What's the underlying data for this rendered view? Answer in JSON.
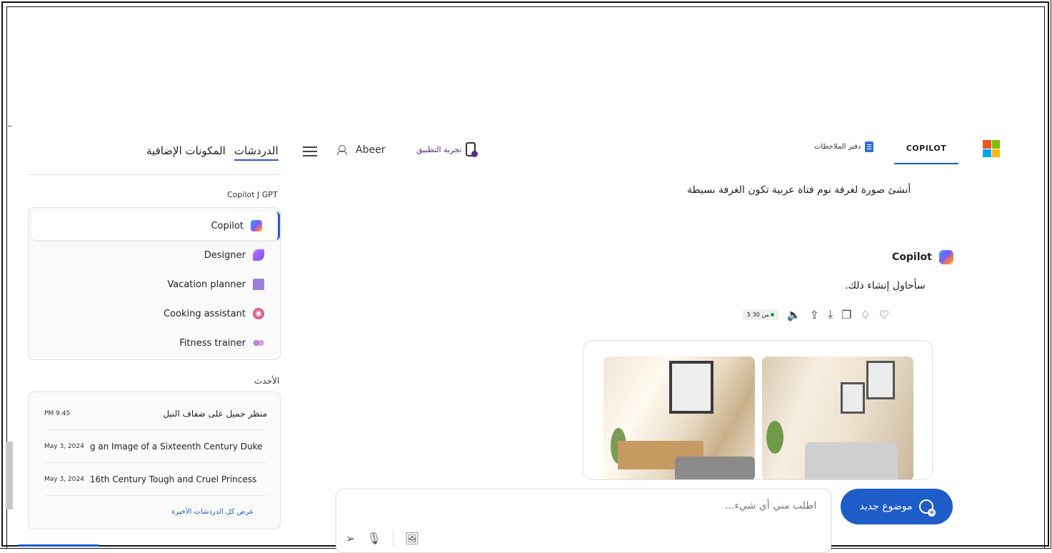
{
  "colors": {
    "accent": "#1e5cc8",
    "app_purple": "#5b2c8a"
  },
  "header": {
    "copilot_tab": "COPILOT",
    "notebook_tab": "دفتر الملاحظات",
    "try_app": "تجربة التطبيق",
    "user_name": "Abeer"
  },
  "sidebar": {
    "tabs": [
      {
        "label": "الدردشات"
      },
      {
        "label": "المكونات الإضافية"
      }
    ],
    "gpt_section_title": "Copilot J GPT",
    "gpts": [
      {
        "label": "Copilot",
        "icon": "copilot-icon"
      },
      {
        "label": "Designer",
        "icon": "designer-icon"
      },
      {
        "label": "Vacation planner",
        "icon": "suitcase-icon"
      },
      {
        "label": "Cooking assistant",
        "icon": "cooking-icon"
      },
      {
        "label": "Fitness trainer",
        "icon": "dumbbell-icon"
      }
    ],
    "recent_title": "الأحدث",
    "recent": [
      {
        "title": "منظر جميل على ضفاف النيل",
        "time": "PM 9:45"
      },
      {
        "title": "g an Image of a Sixteenth Century Duke",
        "time": "May 3, 2024"
      },
      {
        "title": "16th Century Tough and Cruel Princess",
        "time": "May 3, 2024"
      }
    ],
    "view_all": "عرض كل الدردشات الأخيرة"
  },
  "chat": {
    "user_message": "أنشئ صورة لغرفة نوم فتاة عربية تكون الغرفة بسيطة",
    "assistant_name": "Copilot",
    "assistant_message": "سأحاول إنشاء ذلك.",
    "counter": "5 من 30"
  },
  "composer": {
    "placeholder": "اطلب مني أي شيء..."
  },
  "new_topic": "موضوع جديد"
}
